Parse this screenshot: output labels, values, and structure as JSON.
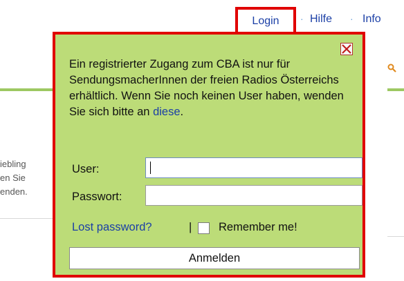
{
  "nav": {
    "login": "Login",
    "separator": "·",
    "hilfe": "Hilfe",
    "info": "Info"
  },
  "background": {
    "line1": "iebling",
    "line2": "en Sie",
    "line3": "enden."
  },
  "popup": {
    "close_icon": "close-icon",
    "message": "Ein registrierter Zugang zum CBA ist nur für SendungsmacherInnen der freien Radios Österreichs erhältlich. Wenn Sie noch keinen User haben, wenden Sie sich bitte an ",
    "message_link": "diese",
    "message_end": ".",
    "user_label": "User:",
    "user_value": "",
    "password_label": "Passwort:",
    "password_value": "",
    "lost_password": "Lost password?",
    "pipe": "|",
    "remember_label": "Remember me!",
    "submit_label": "Anmelden"
  },
  "colors": {
    "accent_red": "#e00000",
    "popup_bg": "#bcdc78",
    "link_blue": "#1b3fa6"
  }
}
